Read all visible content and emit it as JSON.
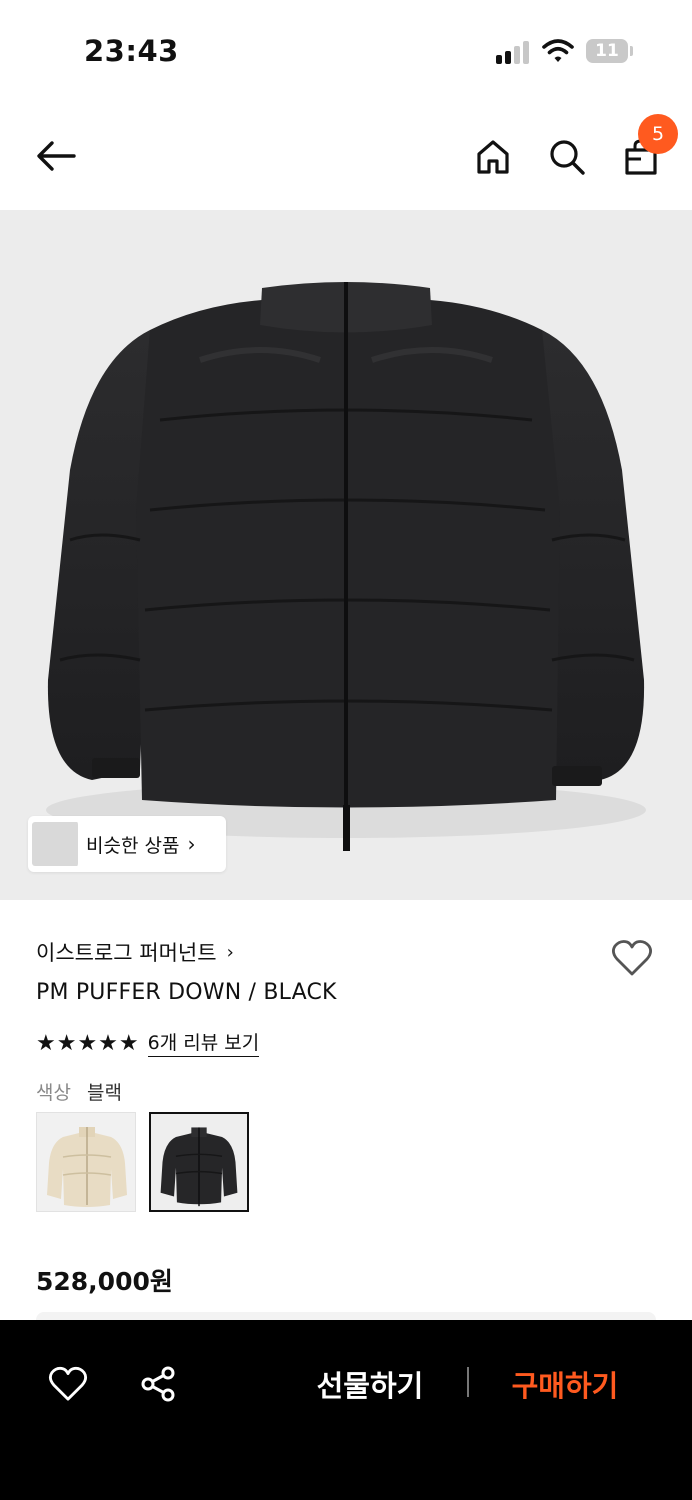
{
  "status_bar": {
    "time": "23:43",
    "battery": "11",
    "icons": [
      "signal-icon",
      "wifi-icon",
      "battery-icon"
    ]
  },
  "header": {
    "icons": [
      "back-arrow-icon",
      "home-icon",
      "search-icon",
      "shopping-bag-icon"
    ],
    "cart_count": "5",
    "accent_color": "#ff5a1f"
  },
  "hero": {
    "similar_label": "비슷한 상품",
    "similar_chevron": "›"
  },
  "product": {
    "brand": "이스트로그 퍼머넌트",
    "brand_chevron": "›",
    "name": "PM PUFFER DOWN / BLACK",
    "rating": 5,
    "stars": "★★★★★",
    "review_link": "6개 리뷰 보기",
    "color_label": "색상",
    "color_value": "블랙",
    "swatches": [
      "cream-jacket-thumbnail",
      "black-jacket-thumbnail"
    ],
    "price": "528,000원"
  },
  "bottom_bar": {
    "gift_label": "선물하기",
    "buy_label": "구매하기",
    "buy_color": "#ff5a1f",
    "icons": [
      "heart-icon",
      "share-icon"
    ]
  }
}
